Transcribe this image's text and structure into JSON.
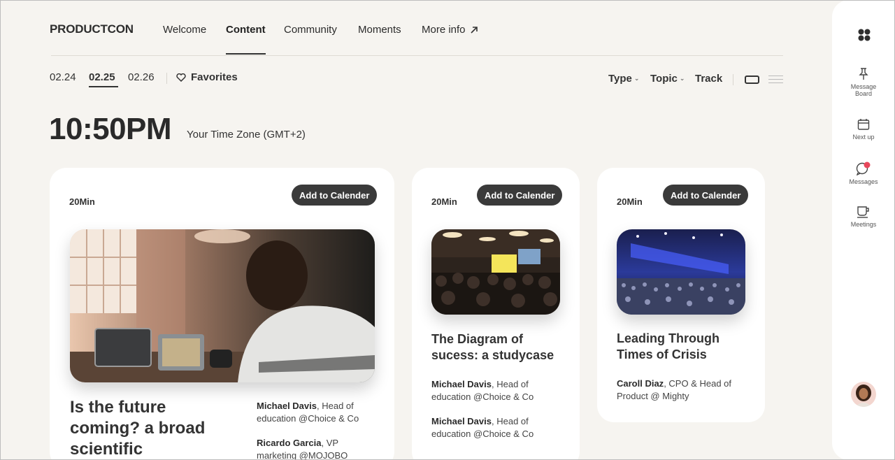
{
  "header": {
    "logo": "PRODUCTCON",
    "nav": [
      "Welcome",
      "Content",
      "Community",
      "Moments",
      "More info"
    ],
    "active_nav": "Content"
  },
  "dates": [
    "02.24",
    "02.25",
    "02.26"
  ],
  "active_date": "02.25",
  "favorites_label": "Favorites",
  "filters": {
    "type": "Type",
    "topic": "Topic",
    "track": "Track"
  },
  "time": {
    "current": "10:50PM",
    "timezone": "Your Time Zone (GMT+2)"
  },
  "cards": [
    {
      "duration": "20Min",
      "button": "Add to Calender",
      "title": "Is the future coming? a broad scientific",
      "speakers": [
        {
          "name": "Michael Davis",
          "role": ", Head of education @Choice & Co"
        },
        {
          "name": "Ricardo Garcia",
          "role": ", VP marketing @MOJOBO"
        }
      ]
    },
    {
      "duration": "20Min",
      "button": "Add to Calender",
      "title": "The Diagram of sucess: a studycase",
      "speakers": [
        {
          "name": "Michael Davis",
          "role": ", Head of education @Choice & Co"
        },
        {
          "name": "Michael Davis",
          "role": ", Head of education @Choice & Co"
        }
      ]
    },
    {
      "duration": "20Min",
      "button": "Add to Calender",
      "title": "Leading Through Times of Crisis",
      "speakers": [
        {
          "name": "Caroll Diaz",
          "role": ", CPO & Head of Product @ Mighty"
        }
      ]
    }
  ],
  "sidebar": [
    {
      "label": "Message Board",
      "icon": "pin-icon"
    },
    {
      "label": "Next up",
      "icon": "calendar-icon"
    },
    {
      "label": "Messages",
      "icon": "chat-icon"
    },
    {
      "label": "Meetings",
      "icon": "cup-icon"
    }
  ],
  "colors": {
    "accent_dark": "#3a3a3a",
    "notification": "#e8475b",
    "background": "#f6f4f0"
  }
}
